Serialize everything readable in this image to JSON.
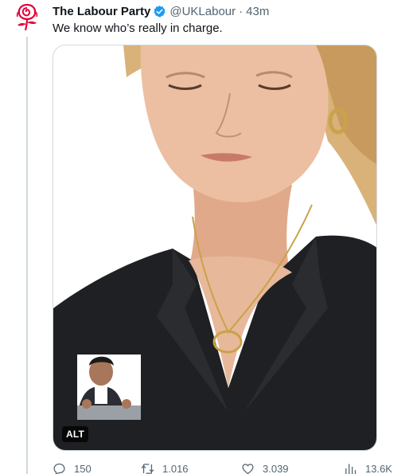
{
  "author": {
    "name": "The Labour Party",
    "handle": "@UKLabour",
    "separator": "·",
    "time": "43m",
    "avatar_icon": "labour-rose-icon",
    "verified_icon": "verified-badge-icon",
    "brand_color": "#e4003b",
    "verified_color": "#1d9bf0"
  },
  "tweet": {
    "text": "We know who’s really in charge."
  },
  "media": {
    "alt_label": "ALT"
  },
  "actions": {
    "replies": "150",
    "retweets": "1.016",
    "likes": "3.039",
    "views": "13.6K"
  },
  "colors": {
    "muted_text": "#536471",
    "border": "#cfd9de",
    "jacket": "#1f2023",
    "skin": "#e8b89a",
    "hair": "#d9b27a"
  }
}
